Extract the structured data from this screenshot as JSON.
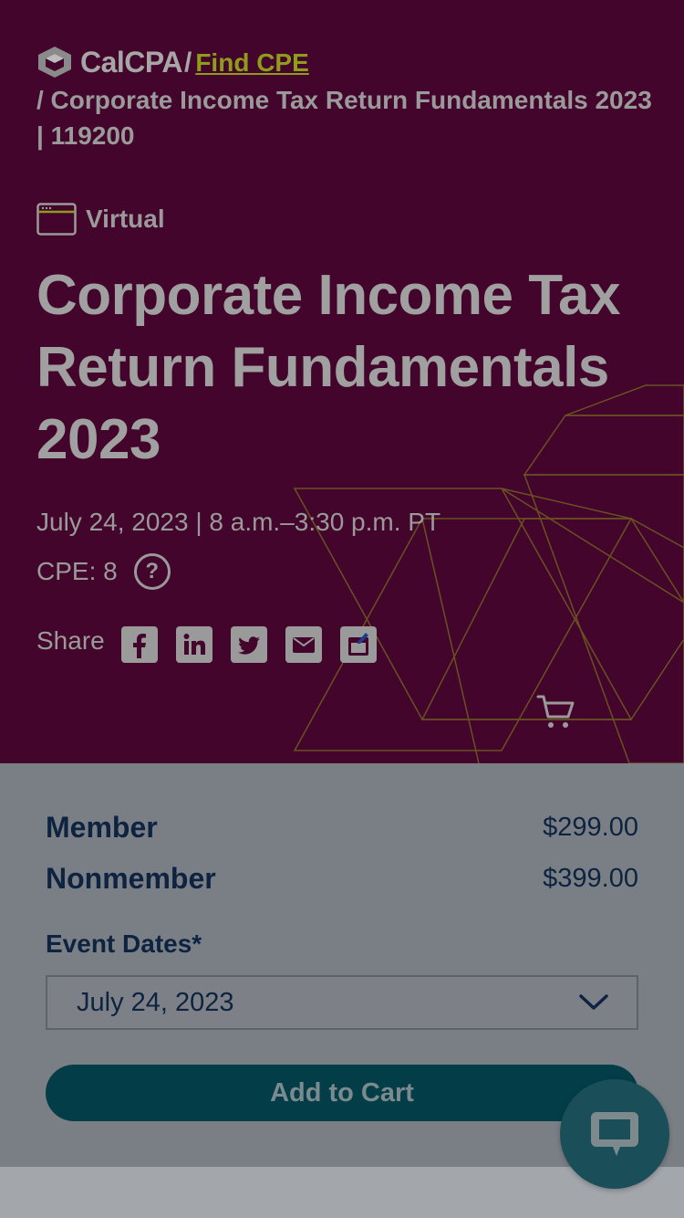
{
  "breadcrumb": {
    "logo_text": "CalCPA",
    "separator": "/",
    "link_label": "Find CPE",
    "trail": "/ Corporate Income Tax Return Fundamentals 2023 | 119200"
  },
  "course": {
    "format_label": "Virtual",
    "title": "Corporate Income Tax Return Fundamentals 2023",
    "date_time": "July 24, 2023 | 8 a.m.–3:30 p.m. PT",
    "cpe": "CPE: 8",
    "help_symbol": "?"
  },
  "share": {
    "label": "Share",
    "buttons": [
      "facebook-icon",
      "linkedin-icon",
      "twitter-icon",
      "email-icon",
      "calendar-icon"
    ]
  },
  "pricing": {
    "member_label": "Member",
    "member_price": "$299.00",
    "nonmember_label": "Nonmember",
    "nonmember_price": "$399.00"
  },
  "event_dates": {
    "label": "Event Dates*",
    "selected": "July 24, 2023"
  },
  "actions": {
    "add_to_cart": "Add to Cart"
  },
  "colors": {
    "hero_bg": "#43052b",
    "link": "#8f9b1a",
    "panel_bg": "#7a7f85",
    "primary_button": "#033e48",
    "text_dark": "#0d2340"
  }
}
